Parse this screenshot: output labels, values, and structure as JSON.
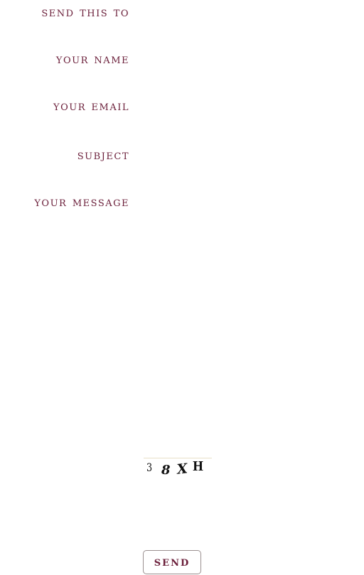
{
  "form": {
    "send_to_label": "SEND THIS TO",
    "name_label": "YOUR NAME",
    "email_label": "YOUR EMAIL",
    "subject_label": "SUBJECT",
    "message_label": "YOUR MESSAGE",
    "send_to_value": "",
    "name_value": "",
    "email_value": "",
    "subject_value": "",
    "message_value": ""
  },
  "captcha": {
    "chars": [
      "3",
      "8",
      "X",
      "H"
    ]
  },
  "submit": {
    "label": "SEND"
  },
  "colors": {
    "label": "#6b1f3a",
    "background": "#ffffff",
    "button_border": "#9a8f8f"
  }
}
